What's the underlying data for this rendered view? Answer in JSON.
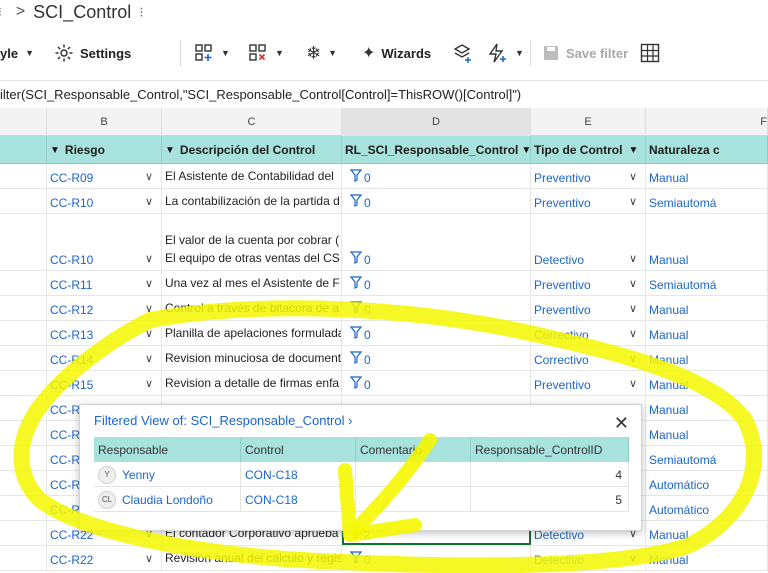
{
  "breadcrumb": {
    "separator": ">",
    "title": "SCI_Control",
    "more": "⁝"
  },
  "toolbar": {
    "style_label": "yle",
    "settings_label": "Settings",
    "wizards_label": "Wizards",
    "save_filter_label": "Save filter"
  },
  "formula": "ilter(SCI_Responsable_Control,\"SCI_Responsable_Control[Control]=ThisROW()[Control]\")",
  "columns": {
    "letters": [
      "B",
      "C",
      "D",
      "E",
      "F"
    ],
    "headers": [
      "Riesgo",
      "Descripción del Control",
      "RL_SCI_Responsable_Control",
      "Tipo de Control",
      "Naturaleza c"
    ]
  },
  "rows": [
    {
      "riesgo": "CC-R09",
      "descripcion": [
        "El Asistente  de Contabilidad del"
      ],
      "rl": "0",
      "tipo": "Preventivo",
      "naturaleza": "Manual"
    },
    {
      "riesgo": "CC-R10",
      "descripcion": [
        "La contabilización de la partida d"
      ],
      "rl": "0",
      "tipo": "Preventivo",
      "naturaleza": "Semiautomá"
    },
    {
      "riesgo": "CC-R10",
      "descripcion": [
        "El valor de la cuenta por cobrar (",
        "El equipo de otras ventas del CS"
      ],
      "rl": "0",
      "tipo": "Detectivo",
      "naturaleza": "Manual"
    },
    {
      "riesgo": "CC-R11",
      "descripcion": [
        "Una vez al mes  el Asistente de F"
      ],
      "rl": "0",
      "tipo": "Preventivo",
      "naturaleza": "Semiautomá"
    },
    {
      "riesgo": "CC-R12",
      "descripcion": [
        "Control a través de bitacora de a"
      ],
      "rl": "0",
      "tipo": "Preventivo",
      "naturaleza": "Manual"
    },
    {
      "riesgo": "CC-R13",
      "descripcion": [
        "Planilla de apelaciones formulada"
      ],
      "rl": "0",
      "tipo": "Correctivo",
      "naturaleza": "Manual"
    },
    {
      "riesgo": "CC-R14",
      "descripcion": [
        "Revision minuciosa de document"
      ],
      "rl": "0",
      "tipo": "Correctivo",
      "naturaleza": "Manual"
    },
    {
      "riesgo": "CC-R15",
      "descripcion": [
        "Revision a detalle de firmas enfa"
      ],
      "rl": "0",
      "tipo": "Preventivo",
      "naturaleza": "Manual"
    },
    {
      "riesgo": "CC-R",
      "descripcion": [
        ""
      ],
      "rl": "",
      "tipo": "",
      "naturaleza": "Manual"
    },
    {
      "riesgo": "CC-R",
      "descripcion": [
        ""
      ],
      "rl": "",
      "tipo": "",
      "naturaleza": "Manual"
    },
    {
      "riesgo": "CC-R",
      "descripcion": [
        ""
      ],
      "rl": "",
      "tipo": "",
      "naturaleza": "Semiautomá"
    },
    {
      "riesgo": "CC-R",
      "descripcion": [
        ""
      ],
      "rl": "",
      "tipo": "",
      "naturaleza": "Automático"
    },
    {
      "riesgo": "CC-R",
      "descripcion": [
        ""
      ],
      "rl": "",
      "tipo": "",
      "naturaleza": "Automático"
    },
    {
      "riesgo": "CC-R22",
      "descripcion": [
        "El contador Corporativo aprueba"
      ],
      "rl": "2",
      "tipo": "Detectivo",
      "naturaleza": "Manual"
    },
    {
      "riesgo": "CC-R22",
      "descripcion": [
        "Revisión anual del calculo y regis"
      ],
      "rl": "0",
      "tipo": "Detectivo",
      "naturaleza": "Manual"
    }
  ],
  "popup": {
    "title": "Filtered View of: SCI_Responsable_Control ›",
    "close": "✕",
    "headers": [
      "Responsable",
      "Control",
      "Comentario",
      "Responsable_ControlID"
    ],
    "rows": [
      {
        "initials": "Y",
        "responsable": "Yenny",
        "control": "CON-C18",
        "comentario": "",
        "id": "4"
      },
      {
        "initials": "CL",
        "responsable": "Claudia Londoño",
        "control": "CON-C18",
        "comentario": "",
        "id": "5"
      }
    ]
  },
  "colors": {
    "header_teal": "#a8e2dc",
    "link_blue": "#1b66c9",
    "highlight_yellow": "#f4f700"
  }
}
